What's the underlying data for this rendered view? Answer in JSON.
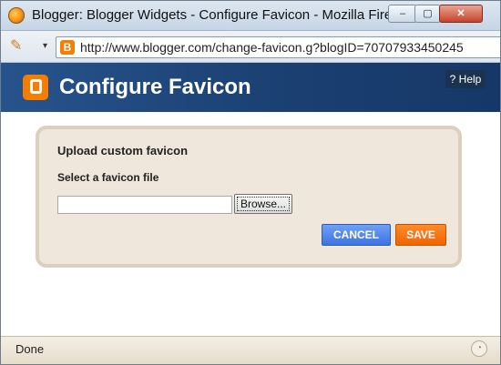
{
  "window": {
    "title": "Blogger: Blogger Widgets - Configure Favicon - Mozilla Firefox",
    "minimize_label": "–",
    "maximize_label": "▢",
    "close_label": "✕"
  },
  "addressbar": {
    "url": "http://www.blogger.com/change-favicon.g?blogID=70707933450245"
  },
  "header": {
    "title": "Configure Favicon",
    "help_label": "? Help"
  },
  "form": {
    "section_title": "Upload custom favicon",
    "file_label": "Select a favicon file",
    "file_value": "",
    "browse_label": "Browse...",
    "cancel_label": "CANCEL",
    "save_label": "SAVE"
  },
  "status": {
    "text": "Done"
  },
  "colors": {
    "blogger_orange": "#f57d00",
    "header_blue": "#1a3f70",
    "cancel_blue": "#3e73e3",
    "panel_beige": "#efe6dc"
  },
  "icons": {
    "browser": "firefox-icon",
    "edit": "pencil-icon",
    "site": "blogger-icon"
  }
}
